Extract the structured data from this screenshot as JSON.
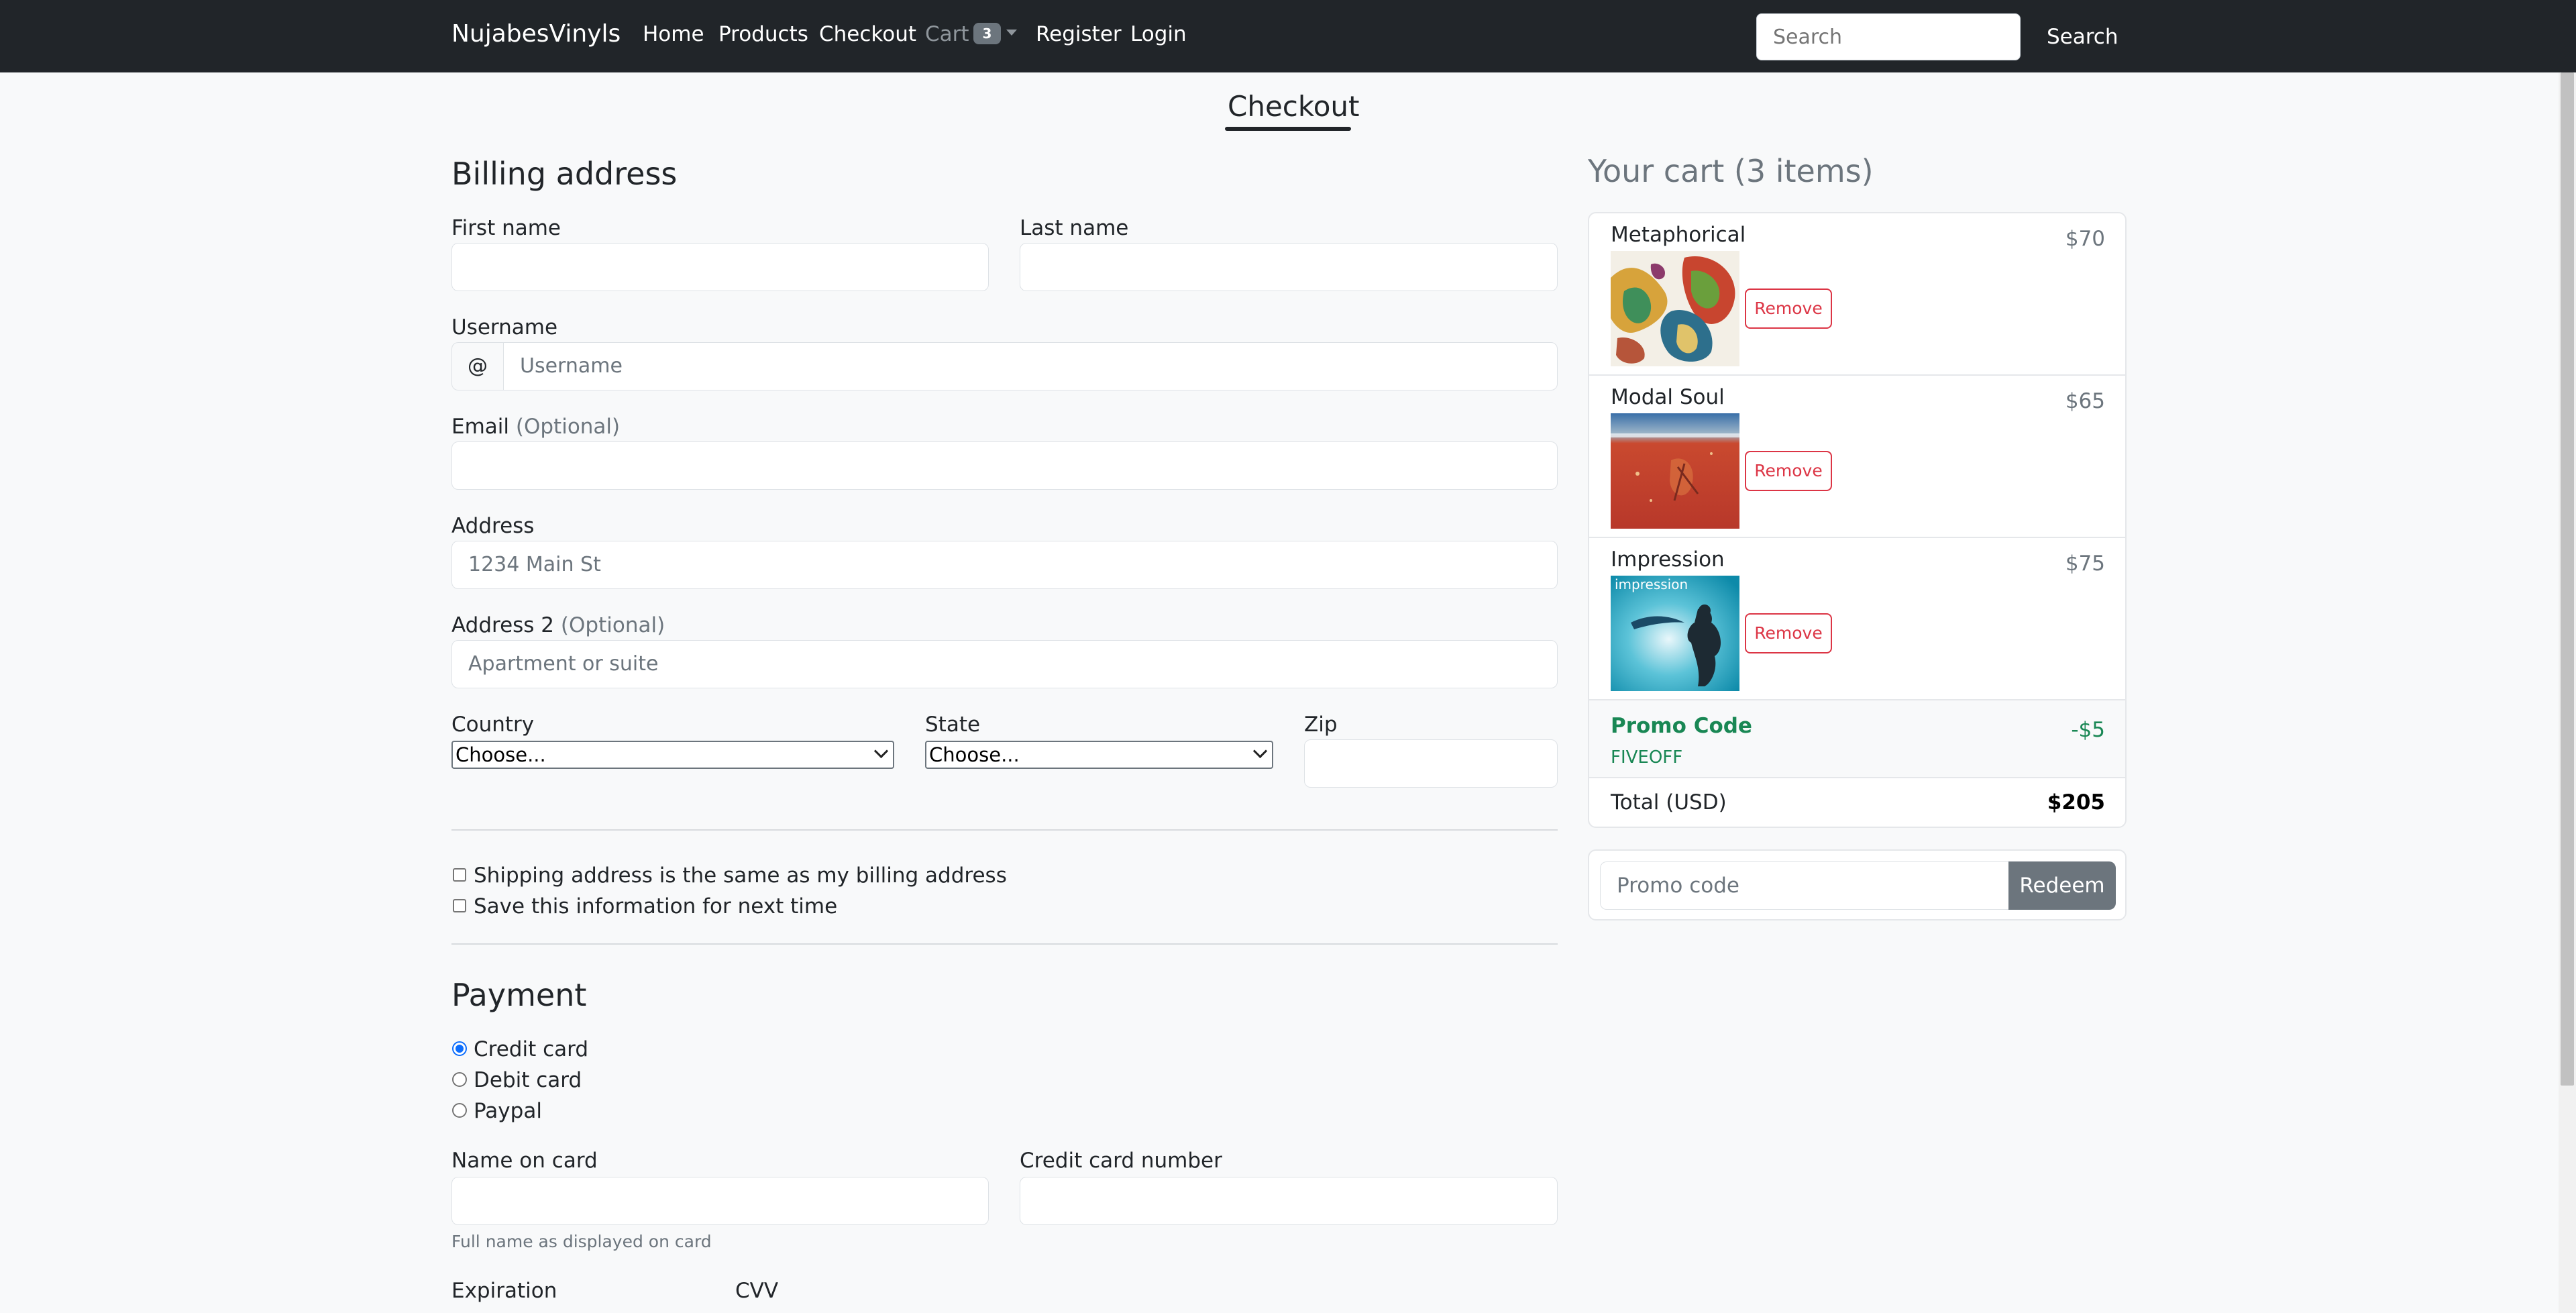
{
  "nav": {
    "brand": "NujabesVinyls",
    "links": [
      "Home",
      "Products",
      "Checkout"
    ],
    "cart_label": "Cart",
    "cart_count": "3",
    "register": "Register",
    "login": "Login",
    "search_placeholder": "Search",
    "search_button": "Search"
  },
  "page_title": "Checkout",
  "billing": {
    "heading": "Billing address",
    "first_name_label": "First name",
    "last_name_label": "Last name",
    "username_label": "Username",
    "username_addon": "@",
    "username_placeholder": "Username",
    "email_label": "Email",
    "email_optional": "(Optional)",
    "address_label": "Address",
    "address_placeholder": "1234 Main St",
    "address2_label": "Address 2",
    "address2_optional": "(Optional)",
    "address2_placeholder": "Apartment or suite",
    "country_label": "Country",
    "country_value": "Choose...",
    "state_label": "State",
    "state_value": "Choose...",
    "zip_label": "Zip",
    "same_address_label": "Shipping address is the same as my billing address",
    "save_info_label": "Save this information for next time"
  },
  "payment": {
    "heading": "Payment",
    "methods": [
      "Credit card",
      "Debit card",
      "Paypal"
    ],
    "selected_method": "Credit card",
    "name_on_card_label": "Name on card",
    "name_on_card_help": "Full name as displayed on card",
    "card_number_label": "Credit card number",
    "expiration_label": "Expiration",
    "cvv_label": "CVV"
  },
  "cart": {
    "title": "Your cart (3 items)",
    "items": [
      {
        "name": "Metaphorical",
        "price": "$70",
        "remove_label": "Remove"
      },
      {
        "name": "Modal Soul",
        "price": "$65",
        "remove_label": "Remove"
      },
      {
        "name": "Impression",
        "price": "$75",
        "remove_label": "Remove",
        "cover_text": "impression"
      }
    ],
    "promo": {
      "title": "Promo Code",
      "code": "FIVEOFF",
      "amount": "-$5"
    },
    "total_label": "Total (USD)",
    "total_value": "$205",
    "promo_input_placeholder": "Promo code",
    "redeem_label": "Redeem"
  },
  "colors": {
    "navbar": "#212529",
    "danger": "#dc3545",
    "success": "#198754",
    "secondary": "#6c757d",
    "primary": "#0d6efd"
  }
}
